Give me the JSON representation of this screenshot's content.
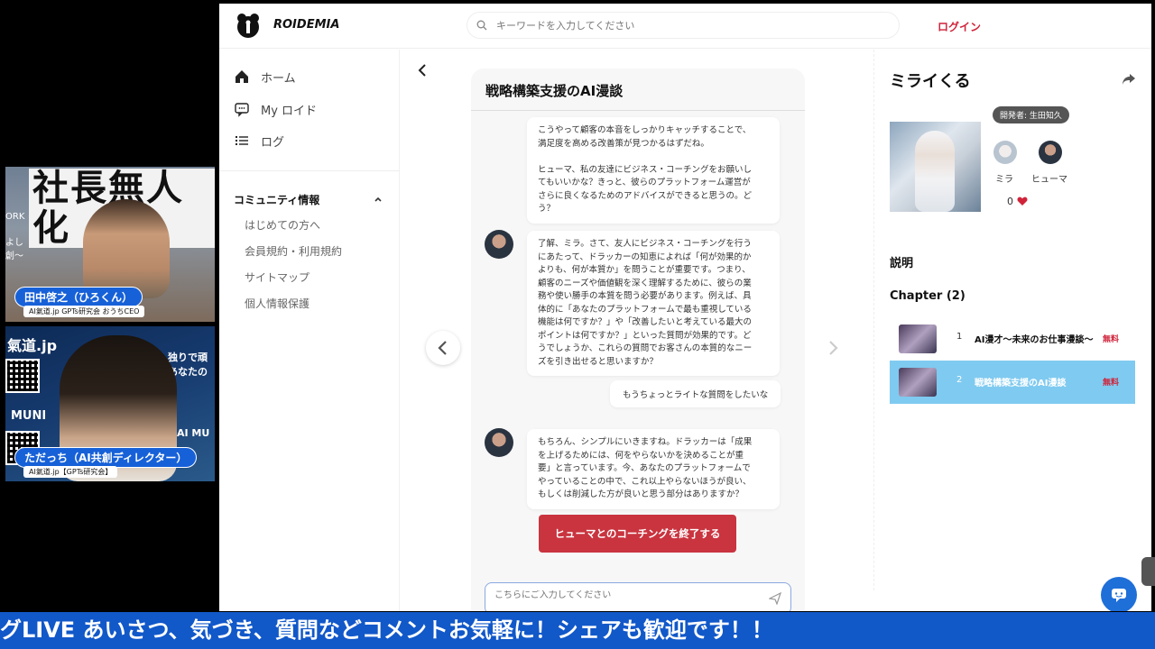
{
  "overlay": {
    "cam1": {
      "title": "社長無人化",
      "side_text_1": "ORK",
      "side_text_2": "よし",
      "side_text_3": "創〜",
      "name": "田中啓之（ひろくん）",
      "sub": "AI氣道.jp GPTs研究会 おうちCEO"
    },
    "cam2": {
      "word_top": "氣道.jp",
      "word_right1": "独りで頑",
      "word_right2": "あなたの",
      "word_muni": "MUNI",
      "word_ai": "AI MU",
      "name": "ただっち（AI共創ディレクター）",
      "sub": "AI氣道.jp【GPTs研究会】"
    }
  },
  "header": {
    "brand": "ROIDEMIA",
    "search_placeholder": "キーワードを入力してください",
    "login": "ログイン"
  },
  "sidebar": {
    "items": [
      {
        "label": "ホーム",
        "icon": "home-icon"
      },
      {
        "label": "My ロイド",
        "icon": "chat-icon"
      },
      {
        "label": "ログ",
        "icon": "list-icon"
      }
    ],
    "community_title": "コミュニティ情報",
    "community_links": [
      "はじめての方へ",
      "会員規約・利用規約",
      "サイトマップ",
      "個人情報保護"
    ]
  },
  "chat": {
    "title": "戦略構築支援のAI漫談",
    "messages": [
      {
        "role": "ai",
        "text": "こうやって顧客の本音をしっかりキャッチすることで、\n満足度を高める改善策が見つかるはずだね。\n\nヒューマ、私の友達にビジネス・コーチングをお願いし\nてもいいかな？きっと、彼らのプラットフォーム運営が\nさらに良くなるためのアドバイスができると思うの。ど\nう？"
      },
      {
        "role": "ai",
        "text": "了解、ミラ。さて、友人にビジネス・コーチングを行う\nにあたって、ドラッカーの知恵によれば「何が効果的か\nよりも、何が本質か」を問うことが重要です。つまり、\n顧客のニーズや価値観を深く理解するために、彼らの業\n務や使い勝手の本質を問う必要があります。例えば、具\n体的に「あなたのプラットフォームで最も重視している\n機能は何ですか？」や「改善したいと考えている最大の\nポイントは何ですか？」といった質問が効果的です。ど\nうでしょうか、これらの質問でお客さんの本質的なニー\nズを引き出せると思いますか？"
      },
      {
        "role": "user",
        "text": "もうちょっとライトな質問をしたいな"
      },
      {
        "role": "ai",
        "text": "もちろん、シンプルにいきますね。ドラッカーは「成果\nを上げるためには、何をやらないかを決めることが重\n要」と言っています。今、あなたのプラットフォームで\nやっていることの中で、これ以上やらないほうが良い、\nもしくは削減した方が良いと思う部分はありますか？"
      }
    ],
    "end_button": "ヒューマとのコーチングを終了する",
    "input_placeholder": "こちらにご入力してください"
  },
  "panel": {
    "title": "ミライくる",
    "developer": "開発者: 生田知久",
    "characters": [
      "ミラ",
      "ヒューマ"
    ],
    "likes": "0",
    "description_heading": "説明",
    "chapter_heading": "Chapter (2)",
    "chapters": [
      {
        "num": "1",
        "title": "AI漫才〜未来のお仕事漫談〜",
        "price": "無料",
        "active": false
      },
      {
        "num": "2",
        "title": "戦略構築支援のAI漫談",
        "price": "無料",
        "active": true
      }
    ]
  },
  "ticker": {
    "text": "グLIVE あいさつ、気づき、質問などコメントお気軽に！シェアも歓迎です！！"
  },
  "colors": {
    "accent_red": "#c9343f",
    "ticker_blue": "#1158c9",
    "active_chapter": "#7fcaf0",
    "fab_blue": "#1f6fd8"
  }
}
